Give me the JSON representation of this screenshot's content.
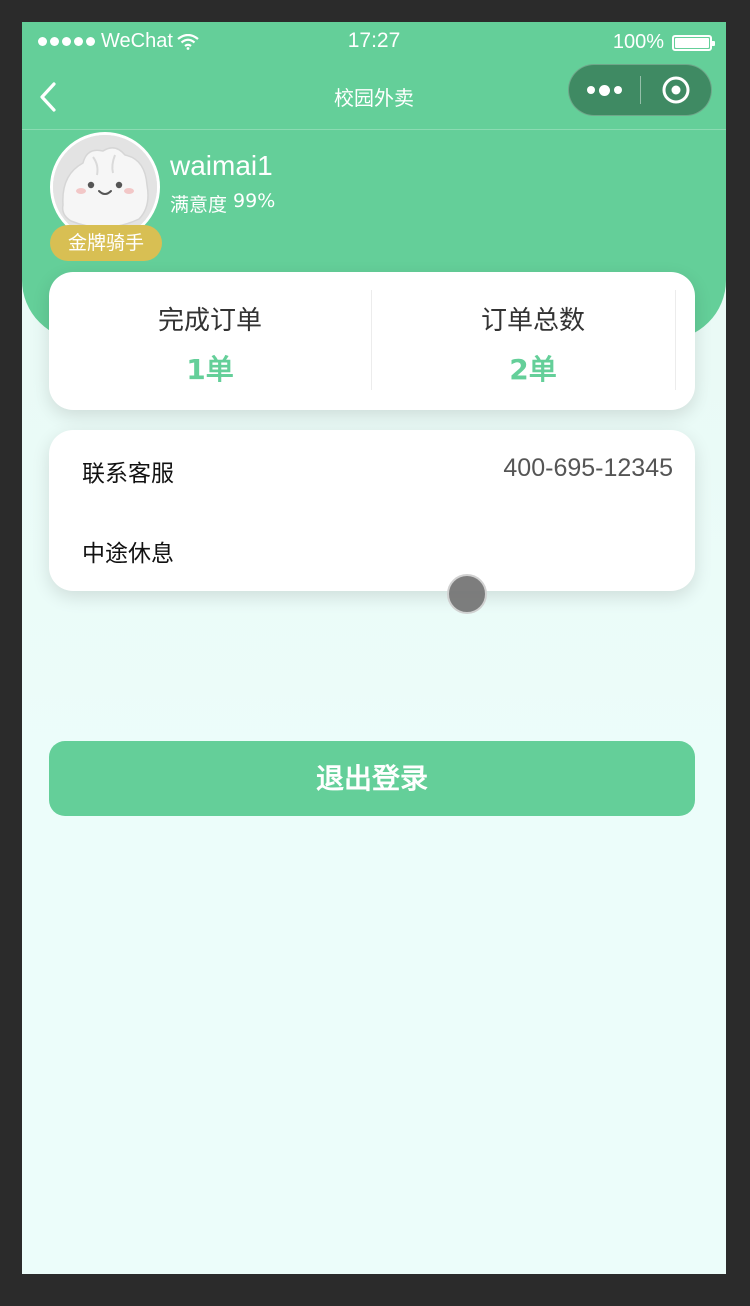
{
  "status_bar": {
    "carrier": "WeChat",
    "time": "17:27",
    "battery": "100%"
  },
  "nav": {
    "title": "校园外卖"
  },
  "profile": {
    "username": "waimai1",
    "satisfaction_label": "满意度",
    "satisfaction_value": "99%",
    "badge": "金牌骑手"
  },
  "stats": [
    {
      "label": "完成订单",
      "value": "1单"
    },
    {
      "label": "订单总数",
      "value": "2单"
    }
  ],
  "menu": [
    {
      "label": "联系客服",
      "value": "400-695-12345"
    },
    {
      "label": "中途休息",
      "value": ""
    }
  ],
  "logout_label": "退出登录",
  "colors": {
    "brand": "#64cf99",
    "badge_gold": "#d8bf53"
  }
}
